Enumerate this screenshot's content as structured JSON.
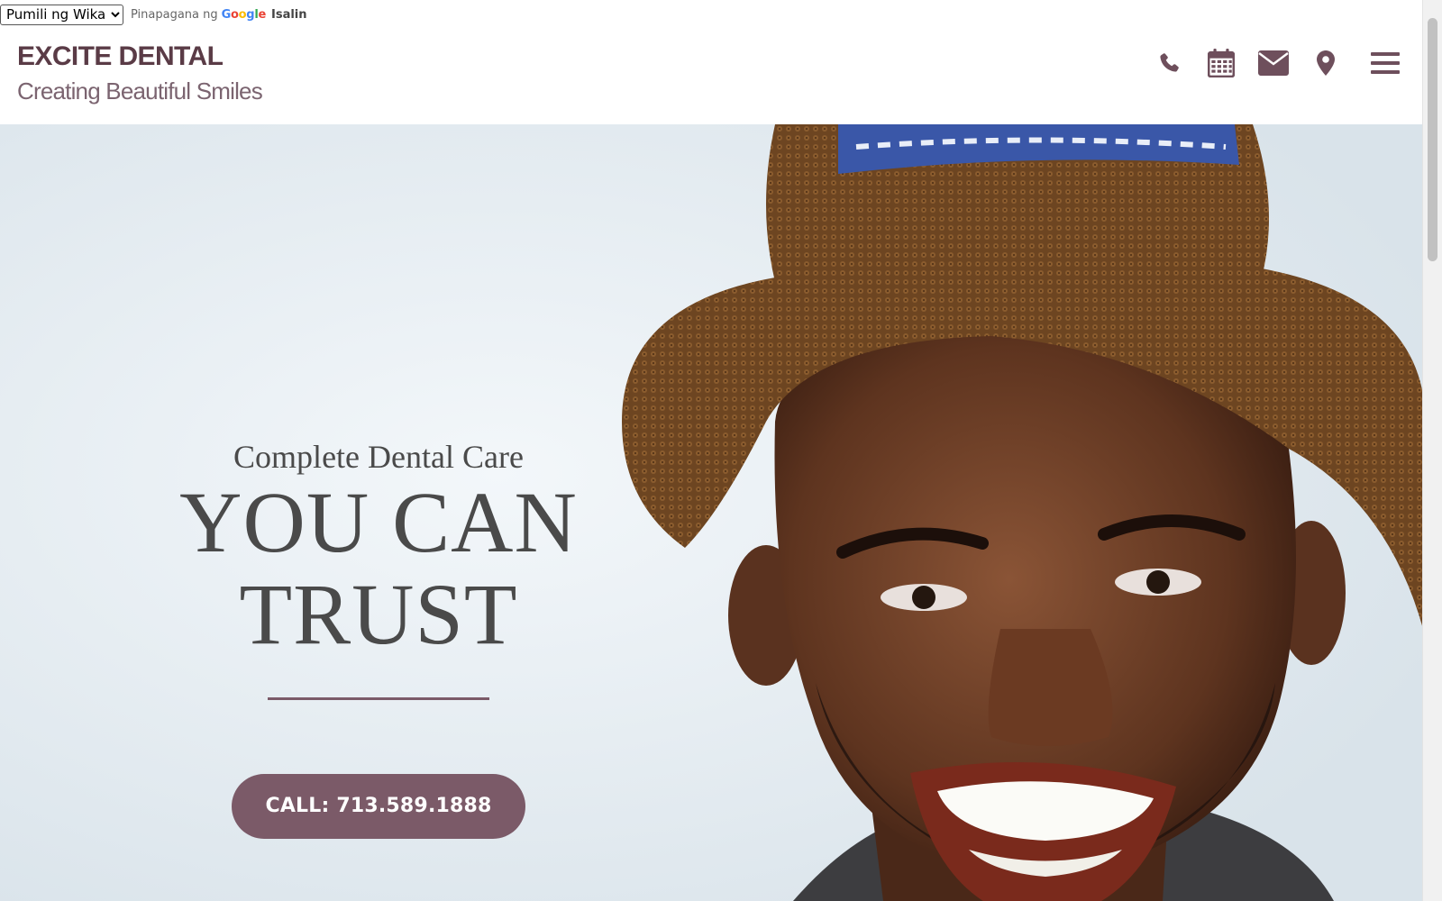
{
  "translate": {
    "select_value": "Pumili ng Wika",
    "powered_by": "Pinapagana ng",
    "google": "Google",
    "translate_label": "Isalin"
  },
  "header": {
    "title": "EXCITE DENTAL",
    "tagline": "Creating Beautiful Smiles",
    "icons": [
      "phone-icon",
      "calendar-icon",
      "envelope-icon",
      "map-marker-icon",
      "hamburger-menu-icon"
    ]
  },
  "hero": {
    "kicker": "Complete Dental Care",
    "headline_line1": "YOU CAN",
    "headline_line2": "TRUST",
    "cta_label": "CALL:  713.589.1888"
  },
  "colors": {
    "brand": "#5a3b46",
    "accent": "#7b5a68",
    "text_dark": "#4a4a4a"
  }
}
